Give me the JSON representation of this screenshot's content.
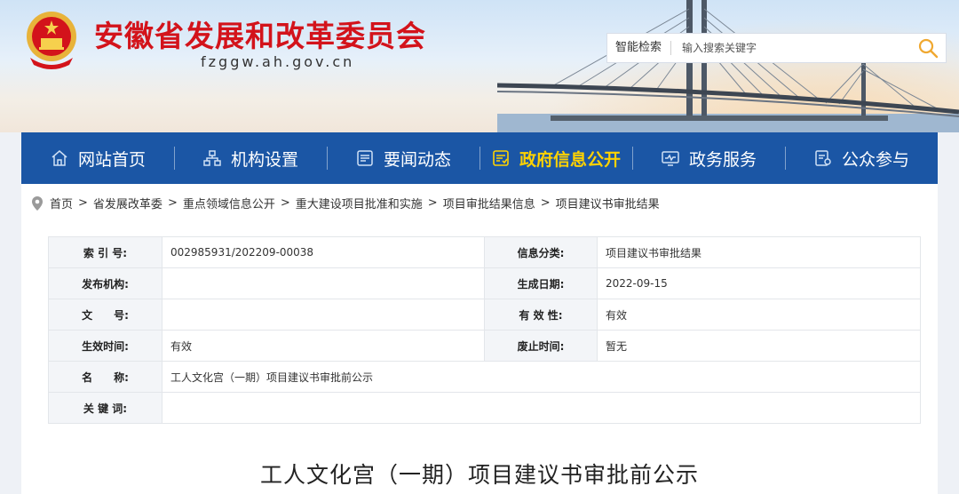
{
  "header": {
    "title": "安徽省发展和改革委员会",
    "domain": "fzggw.ah.gov.cn",
    "emblem_icon": "national-emblem-icon",
    "search": {
      "scope_label": "智能检索",
      "placeholder": "输入搜索关键字",
      "button_icon": "search-icon"
    },
    "accent_color": "#d3131b"
  },
  "nav": {
    "background": "#1b56a5",
    "active_color": "#ffd200",
    "items": [
      {
        "label": "网站首页",
        "icon": "home-icon"
      },
      {
        "label": "机构设置",
        "icon": "org-chart-icon"
      },
      {
        "label": "要闻动态",
        "icon": "news-icon"
      },
      {
        "label": "政府信息公开",
        "icon": "document-icon",
        "active": true
      },
      {
        "label": "政务服务",
        "icon": "monitor-icon"
      },
      {
        "label": "公众参与",
        "icon": "participation-icon"
      }
    ]
  },
  "breadcrumb": {
    "icon": "location-pin-icon",
    "separator": ">",
    "items": [
      "首页",
      "省发展改革委",
      "重点领域信息公开",
      "重大建设项目批准和实施",
      "项目审批结果信息",
      "项目建议书审批结果"
    ]
  },
  "info": {
    "index_label": "索 引 号:",
    "index_value": "002985931/202209-00038",
    "category_label": "信息分类:",
    "category_value": "项目建议书审批结果",
    "publisher_label": "发布机构:",
    "publisher_value": "",
    "created_label": "生成日期:",
    "created_value": "2022-09-15",
    "docno_label": "文　　号:",
    "docno_value": "",
    "validity_label": "有 效 性:",
    "validity_value": "有效",
    "effective_label": "生效时间:",
    "effective_value": "有效",
    "repeal_label": "废止时间:",
    "repeal_value": "暂无",
    "name_label": "名　　称:",
    "name_value": "工人文化宫（一期）项目建议书审批前公示",
    "keywords_label": "关 键 词:",
    "keywords_value": ""
  },
  "article": {
    "title": "工人文化宫（一期）项目建议书审批前公示"
  }
}
